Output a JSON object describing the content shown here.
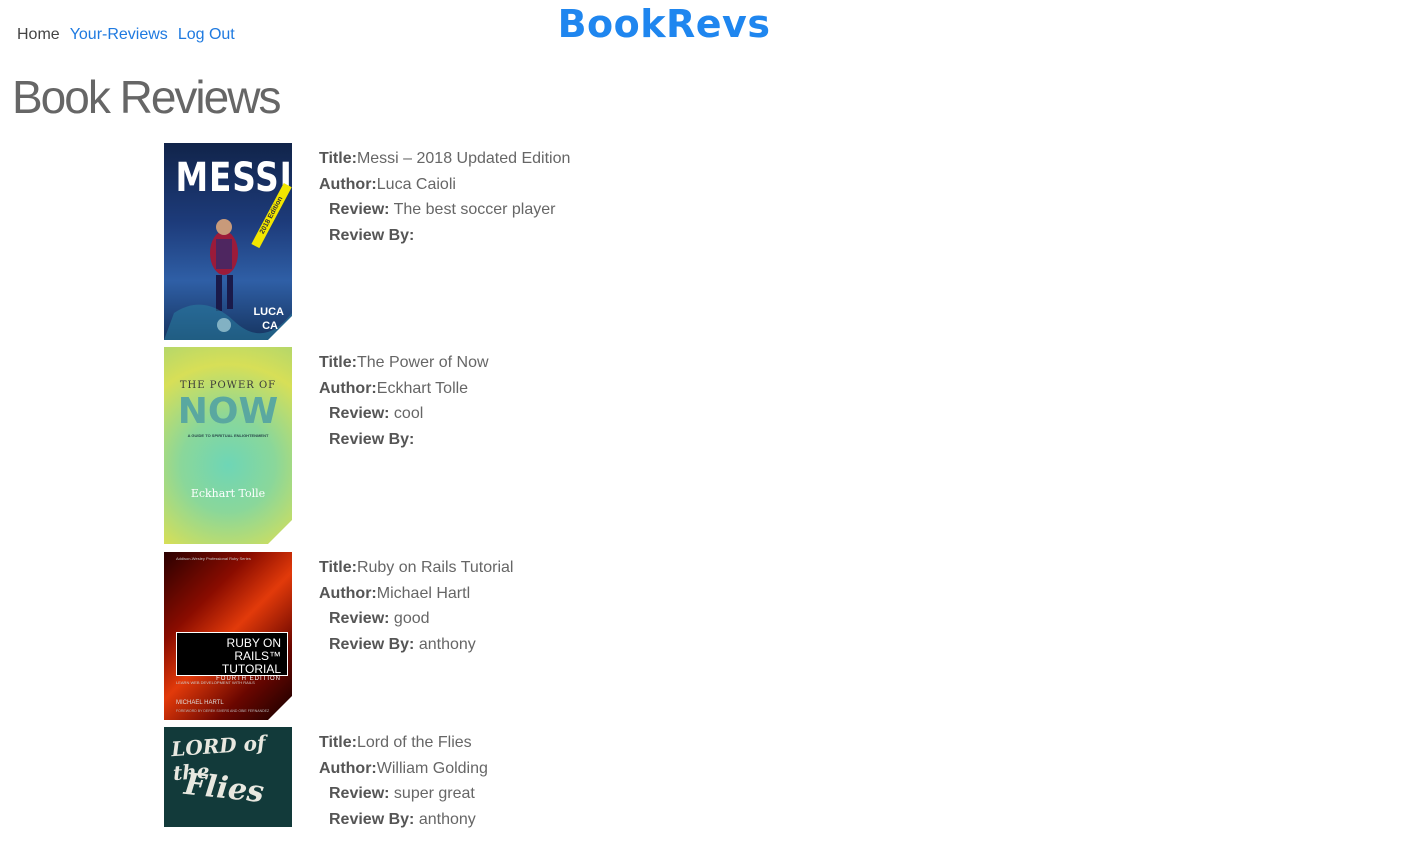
{
  "nav": {
    "home": "Home",
    "your_reviews": "Your-Reviews",
    "logout": "Log Out"
  },
  "brand": "BookRevs",
  "page_title": "Book Reviews",
  "labels": {
    "title": "Title:",
    "author": "Author:",
    "review": "Review:",
    "review_by": "Review By:"
  },
  "reviews": [
    {
      "title": "Messi – 2018 Updated Edition",
      "author": "Luca Caioli",
      "review": "The best soccer player",
      "review_by": "",
      "cover_text": [
        "MESSI",
        "2018 Edition",
        "LUCA",
        "CA"
      ]
    },
    {
      "title": "The Power of Now",
      "author": "Eckhart Tolle",
      "review": "cool",
      "review_by": "",
      "cover_text": [
        "THE POWER OF",
        "NOW",
        "A GUIDE TO SPIRITUAL ENLIGHTENMENT",
        "Eckhart Tolle"
      ]
    },
    {
      "title": "Ruby on Rails Tutorial",
      "author": "Michael Hartl",
      "review": "good",
      "review_by": "anthony",
      "cover_text": [
        "Addison-Wesley Professional Ruby Series",
        "RUBY ON RAILS™",
        "TUTORIAL",
        "FOURTH EDITION",
        "LEARN WEB DEVELOPMENT WITH RAILS",
        "MICHAEL HARTL",
        "FOREWORD BY DEREK SIVERS AND OBIE FERNANDEZ"
      ]
    },
    {
      "title": "Lord of the Flies",
      "author": "William Golding",
      "review": "super great",
      "review_by": "anthony",
      "cover_text": [
        "LORD of the",
        "Flies"
      ]
    }
  ]
}
